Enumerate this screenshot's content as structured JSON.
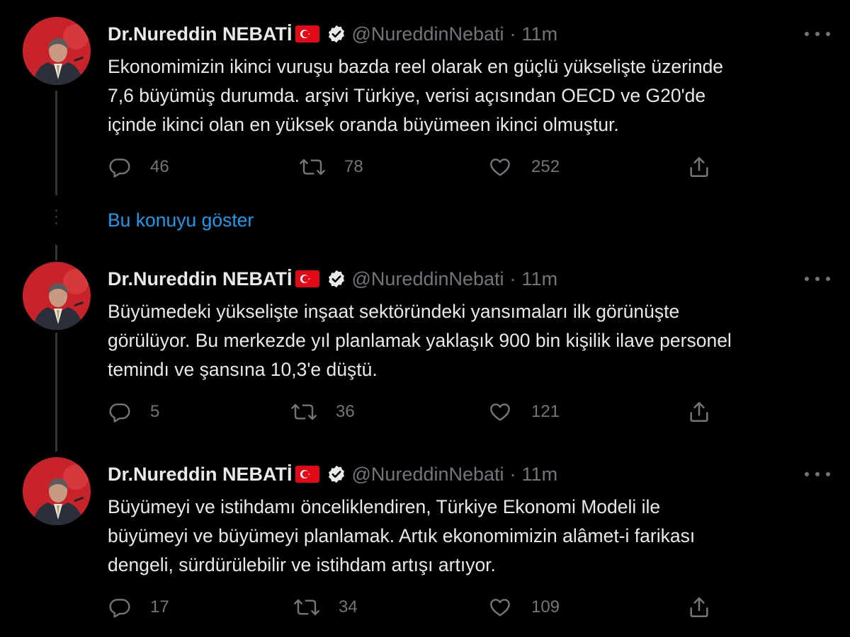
{
  "author": {
    "name": "Dr.Nureddin NEBATİ",
    "handle": "@NureddinNebati",
    "separator": "·",
    "verified": true,
    "flag_icon": "turkey-flag-icon"
  },
  "show_thread": "Bu konuyu göster",
  "tweets": [
    {
      "time": "11m",
      "text": "Ekonomimizin ikinci vuruşu bazda reel olarak en güçlü yükselişte üzerinde\n7,6 büyümüş durumda. arşivi Türkiye, verisi açısından OECD ve G20'de\niçinde ikinci olan en yüksek oranda büyümeen ikinci olmuştur.",
      "replies": "46",
      "retweets": "78",
      "likes": "252"
    },
    {
      "time": "11m",
      "text": "Büyümedeki yükselişte inşaat sektöründeki yansımaları ilk görünüşte\ngörülüyor. Bu merkezde yıl planlamak yaklaşık 900 bin kişilik ilave personel\ntemindı ve şansına 10,3'e düştü.",
      "replies": "5",
      "retweets": "36",
      "likes": "121"
    },
    {
      "time": "11m",
      "text": "Büyümeyi ve istihdamı önceliklendiren, Türkiye Ekonomi Modeli ile\nbüyümeyi ve büyümeyi planlamak. Artık ekonomimizin alâmet-i farikası\ndengeli, sürdürülebilir ve istihdam artışı artıyor.",
      "replies": "17",
      "retweets": "34",
      "likes": "109"
    }
  ],
  "colors": {
    "background": "#000000",
    "text": "#e7e9ea",
    "secondary": "#71767b",
    "link": "#1d9bf0",
    "thread_line": "#333639",
    "avatar_red": "#c8222b",
    "flag_red": "#e30a17"
  }
}
